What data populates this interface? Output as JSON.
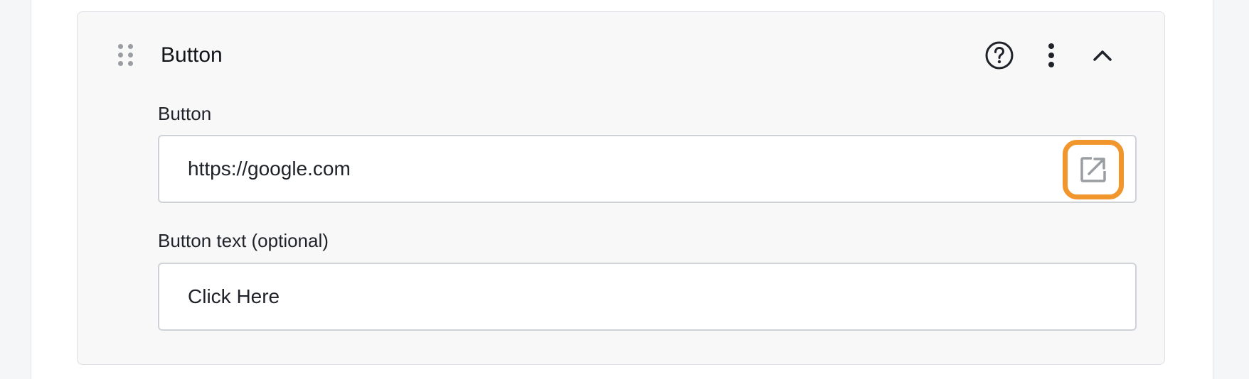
{
  "block": {
    "title": "Button",
    "icons": {
      "drag": "drag-handle-icon",
      "help": "help-circle-icon",
      "more": "more-vertical-icon",
      "collapse": "chevron-up-icon"
    }
  },
  "fields": {
    "url": {
      "label": "Button",
      "value": "https://google.com",
      "action_icon": "open-external-icon"
    },
    "text": {
      "label": "Button text (optional)",
      "value": "Click Here"
    }
  },
  "colors": {
    "highlight": "#f0962c",
    "card_background": "#f8f8f8",
    "border": "#cfd3d8"
  }
}
